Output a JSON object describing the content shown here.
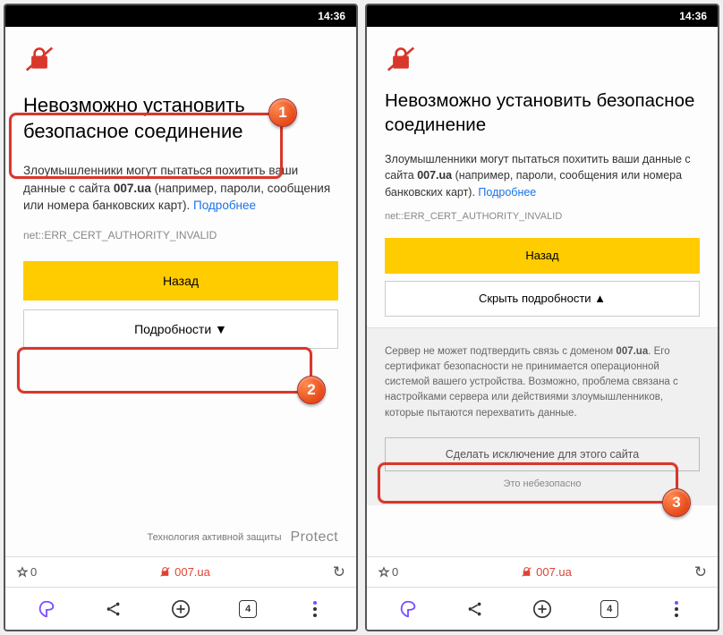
{
  "status": {
    "time": "14:36"
  },
  "page": {
    "title": "Невозможно установить безопасное соединение",
    "desc_prefix": "Злоумышленники могут пытаться похитить ваши данные с сайта ",
    "desc_site": "007.ua",
    "desc_suffix": " (например, пароли, сообщения или номера банковских карт). ",
    "more_link": "Подробнее",
    "error_code": "net::ERR_CERT_AUTHORITY_INVALID",
    "back_button": "Назад",
    "details_button": "Подробности ▼",
    "hide_details_button": "Скрыть подробности ▲"
  },
  "protect": {
    "tagline": "Технология активной защиты",
    "logo": "Protect"
  },
  "details": {
    "text_prefix": "Сервер не может подтвердить связь с доменом ",
    "text_site": "007.ua",
    "text_suffix": ". Его сертификат безопасности не принимается операционной системой вашего устройства. Возможно, проблема связана с настройками сервера или действиями злоумышленников, которые пытаются перехватить данные.",
    "exception_button": "Сделать исключение для этого сайта",
    "unsafe_text": "Это небезопасно"
  },
  "urlbar": {
    "star_count": "0",
    "site": "007.ua",
    "tab_count": "4"
  },
  "annotations": {
    "b1": "1",
    "b2": "2",
    "b3": "3"
  }
}
